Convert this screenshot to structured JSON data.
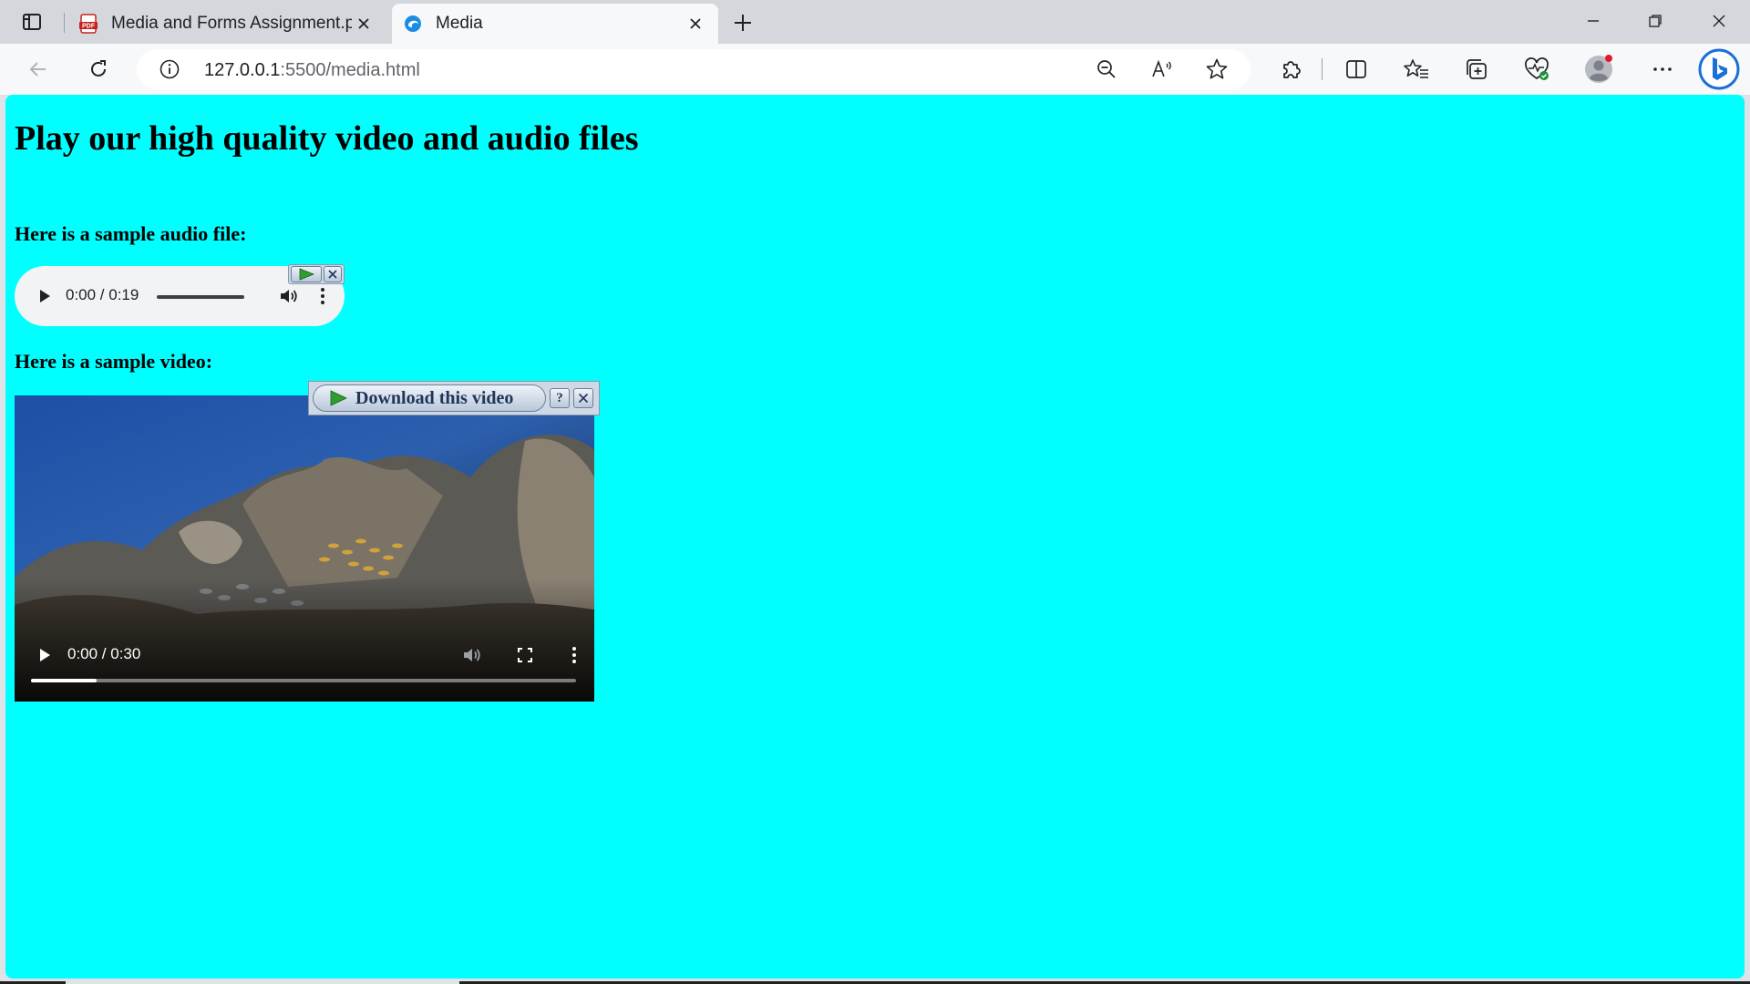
{
  "tabs": [
    {
      "title": "Media and Forms Assignment.pd",
      "favicon": "pdf-icon",
      "active": false
    },
    {
      "title": "Media",
      "favicon": "edge-icon",
      "active": true
    }
  ],
  "address_bar": {
    "host": "127.0.0.1",
    "path": ":5500/media.html"
  },
  "toolbar_icons": [
    "back-icon",
    "refresh-icon",
    "info-icon",
    "zoom-out-icon",
    "read-aloud-icon",
    "favorite-star-icon",
    "extensions-icon",
    "split-screen-icon",
    "favorites-icon",
    "collections-icon",
    "browser-essentials-icon",
    "profile-icon",
    "more-icon",
    "bing-copilot-icon"
  ],
  "page": {
    "title": "Play our high quality video and audio files",
    "audio_label": "Here is a sample audio file:",
    "video_label": "Here is a sample video:",
    "audio": {
      "time": "0:00 / 0:19"
    },
    "video": {
      "time": "0:00 / 0:30",
      "progress": 0.12
    },
    "download_popup": {
      "label": "Download this video",
      "help": "?"
    }
  },
  "colors": {
    "page_background": "#00ffff",
    "chrome_background": "#f7f8fa",
    "tab_strip": "#d4d7db"
  }
}
